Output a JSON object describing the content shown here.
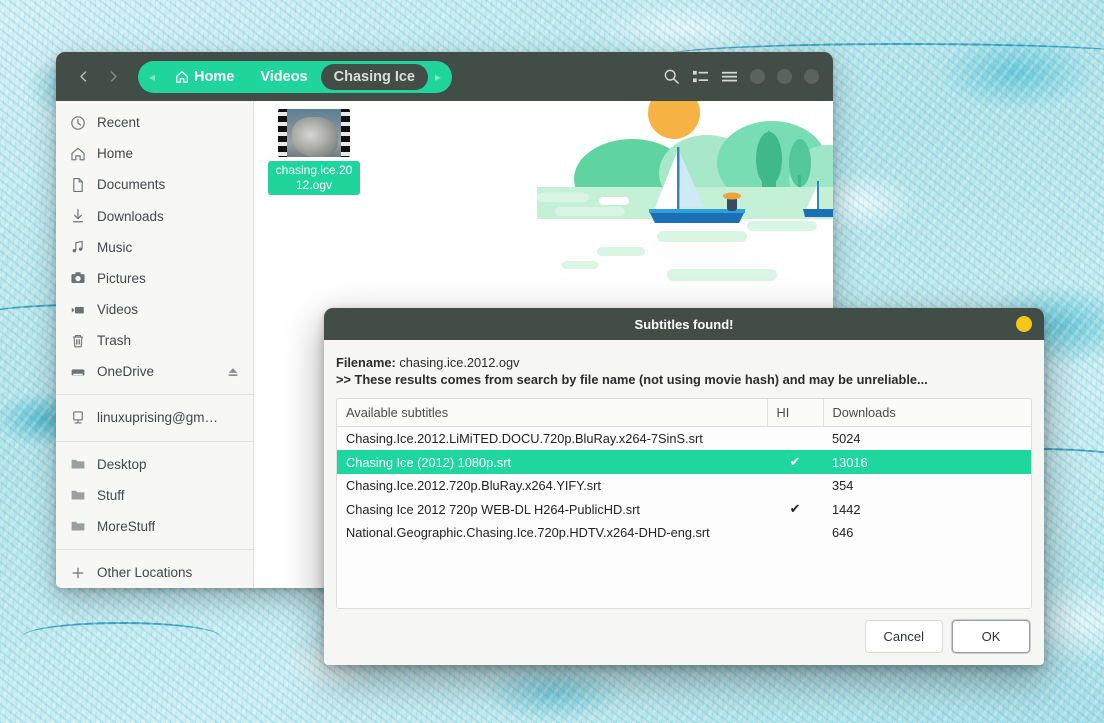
{
  "window": {
    "nav": {
      "back_icon": "chevron-left-icon",
      "forward_icon": "chevron-right-icon"
    },
    "breadcrumb": {
      "left_arrow": "◂",
      "right_arrow": "▸",
      "items": [
        {
          "label": "Home",
          "icon": "home-icon",
          "active": false
        },
        {
          "label": "Videos",
          "icon": "",
          "active": false
        },
        {
          "label": "Chasing Ice",
          "icon": "",
          "active": true
        }
      ]
    },
    "actions": [
      {
        "name": "search-icon",
        "glyph": "search"
      },
      {
        "name": "list-view-icon",
        "glyph": "list"
      },
      {
        "name": "menu-icon",
        "glyph": "menu"
      }
    ],
    "window_controls": [
      "minimize-button",
      "maximize-button",
      "close-button"
    ]
  },
  "sidebar": {
    "items": [
      {
        "label": "Recent",
        "icon": "clock-icon"
      },
      {
        "label": "Home",
        "icon": "home-icon"
      },
      {
        "label": "Documents",
        "icon": "document-icon"
      },
      {
        "label": "Downloads",
        "icon": "download-icon"
      },
      {
        "label": "Music",
        "icon": "music-note-icon"
      },
      {
        "label": "Pictures",
        "icon": "camera-icon"
      },
      {
        "label": "Videos",
        "icon": "video-icon"
      },
      {
        "label": "Trash",
        "icon": "trash-icon"
      },
      {
        "label": "OneDrive",
        "icon": "drive-icon",
        "eject": "eject-icon"
      }
    ],
    "account": {
      "label": "linuxuprising@gm…",
      "icon": "network-computer-icon"
    },
    "bookmarks": [
      {
        "label": "Desktop",
        "icon": "folder-icon"
      },
      {
        "label": "Stuff",
        "icon": "folder-icon"
      },
      {
        "label": "MoreStuff",
        "icon": "folder-icon"
      }
    ],
    "other_locations": {
      "label": "Other Locations",
      "icon": "plus-icon"
    }
  },
  "files": [
    {
      "name": "chasing.ice.2012.ogv",
      "selected": true,
      "icon": "video-thumbnail"
    }
  ],
  "dialog": {
    "title": "Subtitles found!",
    "close_icon": "close-button",
    "filename_label": "Filename:",
    "filename_value": "chasing.ice.2012.ogv",
    "warning": ">> These results comes from search by file name (not using movie hash) and may be unreliable...",
    "table": {
      "headers": [
        "Available subtitles",
        "HI",
        "Downloads"
      ],
      "rows": [
        {
          "name": "Chasing.Ice.2012.LiMiTED.DOCU.720p.BluRay.x264-7SinS.srt",
          "hi": "",
          "downloads": "5024",
          "selected": false
        },
        {
          "name": "Chasing Ice (2012) 1080p.srt",
          "hi": "✔",
          "downloads": "13016",
          "selected": true
        },
        {
          "name": "Chasing.Ice.2012.720p.BluRay.x264.YIFY.srt",
          "hi": "",
          "downloads": "354",
          "selected": false
        },
        {
          "name": "Chasing Ice 2012 720p WEB-DL H264-PublicHD.srt",
          "hi": "✔",
          "downloads": "1442",
          "selected": false
        },
        {
          "name": "National.Geographic.Chasing.Ice.720p.HDTV.x264-DHD-eng.srt",
          "hi": "",
          "downloads": "646",
          "selected": false
        }
      ]
    },
    "buttons": {
      "cancel": "Cancel",
      "ok": "OK"
    }
  },
  "colors": {
    "accent_green": "#1ed79f",
    "titlebar_dark": "#434d48",
    "close_yellow": "#f5c518",
    "wallpaper_teal": "#c8eaf0"
  }
}
